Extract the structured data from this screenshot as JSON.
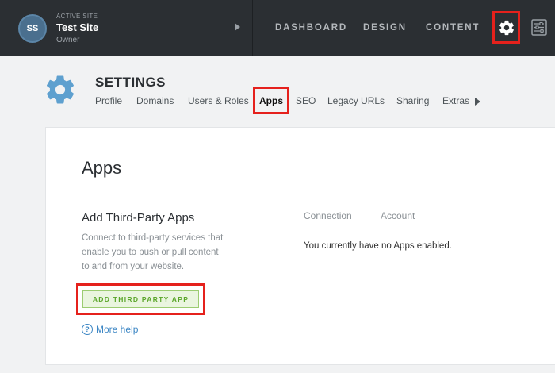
{
  "topbar": {
    "active_site_label": "ACTIVE SITE",
    "avatar_initials": "SS",
    "site_name": "Test Site",
    "site_role": "Owner",
    "nav": [
      "DASHBOARD",
      "DESIGN",
      "CONTENT"
    ],
    "highlight_color": "#e5211c"
  },
  "settings": {
    "title": "SETTINGS",
    "tabs": [
      "Profile",
      "Domains",
      "Users & Roles",
      "Apps",
      "SEO",
      "Legacy URLs",
      "Sharing",
      "Extras"
    ],
    "active_tab": "Apps",
    "accent_color": "#5ea0cf"
  },
  "apps": {
    "title": "Apps",
    "section_title": "Add Third-Party Apps",
    "description": "Connect to third-party services that enable you to push or pull content to and from your website.",
    "add_button": "ADD THIRD PARTY APP",
    "help_link": "More help",
    "columns": [
      "Connection",
      "Account"
    ],
    "empty_message": "You currently have no Apps enabled."
  }
}
